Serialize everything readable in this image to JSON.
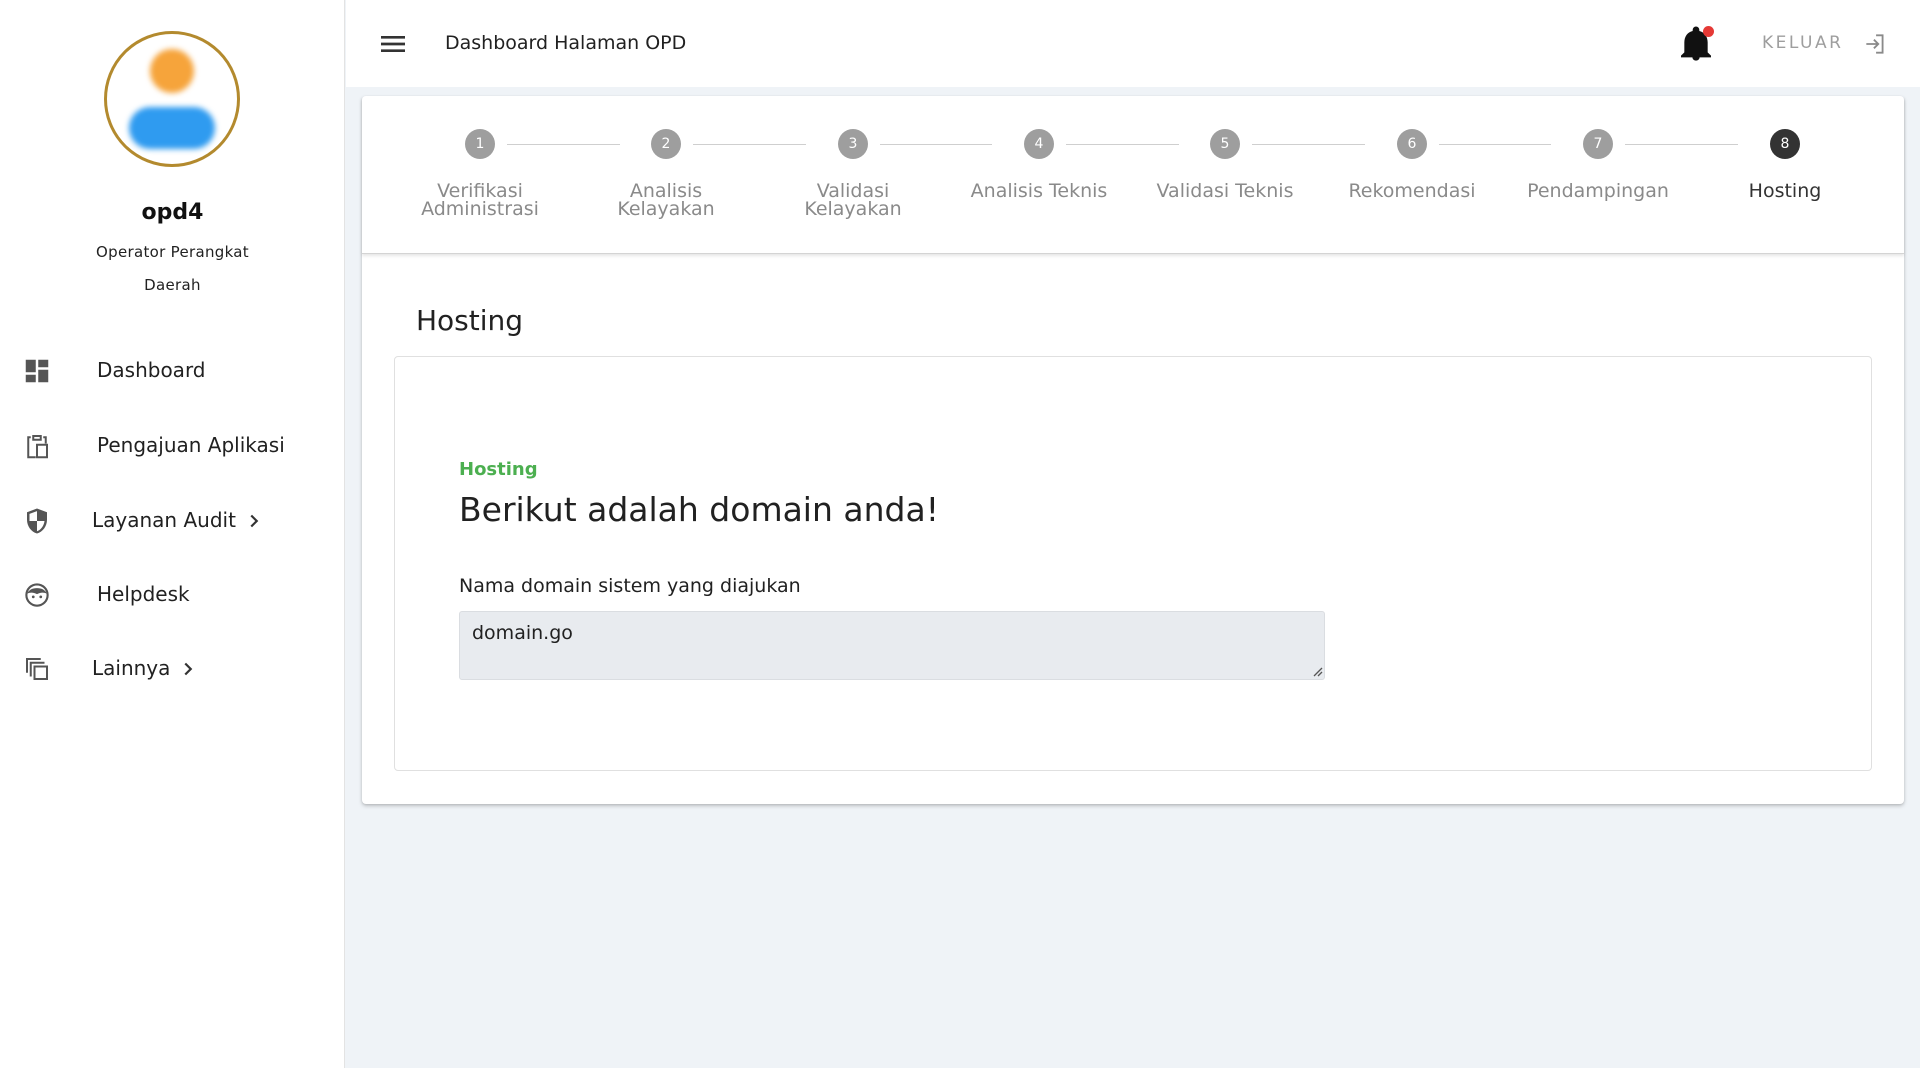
{
  "user": {
    "name": "opd4",
    "role": "Operator Perangkat Daerah"
  },
  "sidebar": {
    "items": [
      {
        "label": "Dashboard",
        "icon": "dashboard-icon",
        "has_submenu": false
      },
      {
        "label": "Pengajuan Aplikasi",
        "icon": "clipboard-icon",
        "has_submenu": false
      },
      {
        "label": "Layanan Audit",
        "icon": "shield-icon",
        "has_submenu": true
      },
      {
        "label": "Helpdesk",
        "icon": "support-agent-icon",
        "has_submenu": false
      },
      {
        "label": "Lainnya",
        "icon": "copy-icon",
        "has_submenu": true
      }
    ]
  },
  "header": {
    "title": "Dashboard Halaman OPD",
    "logout_label": "KELUAR",
    "notification_badge": true
  },
  "stepper": {
    "active_step": 8,
    "steps": [
      {
        "number": "1",
        "label": "Verifikasi Administrasi"
      },
      {
        "number": "2",
        "label": "Analisis Kelayakan"
      },
      {
        "number": "3",
        "label": "Validasi Kelayakan"
      },
      {
        "number": "4",
        "label": "Analisis Teknis"
      },
      {
        "number": "5",
        "label": "Validasi Teknis"
      },
      {
        "number": "6",
        "label": "Rekomendasi"
      },
      {
        "number": "7",
        "label": "Pendampingan"
      },
      {
        "number": "8",
        "label": "Hosting"
      }
    ]
  },
  "content": {
    "section_title": "Hosting",
    "kicker": "Hosting",
    "heading": "Berikut adalah domain anda!",
    "field_label": "Nama domain sistem yang diajukan",
    "field_value": "domain.go"
  },
  "colors": {
    "accent_green": "#4caf50",
    "step_active": "#333333",
    "step_inactive": "#9e9e9e",
    "notification_dot": "#e53935",
    "avatar_ring": "#b38a2e"
  }
}
